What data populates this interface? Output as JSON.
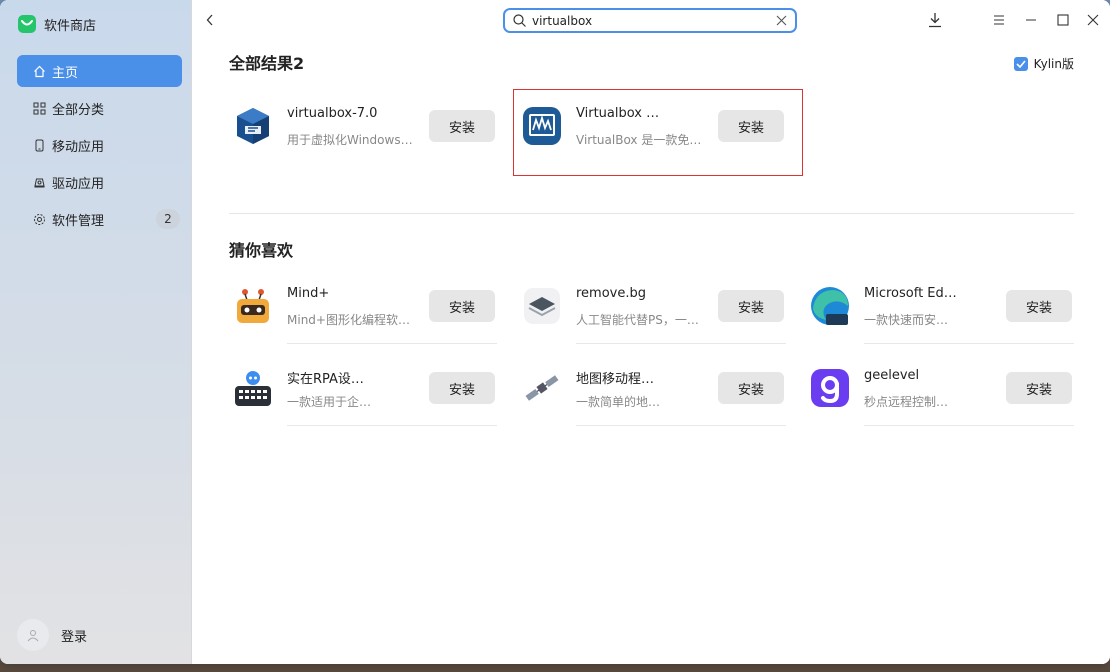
{
  "app": {
    "title": "软件商店"
  },
  "sidebar": {
    "items": [
      {
        "label": "主页",
        "icon": "home-icon",
        "active": true
      },
      {
        "label": "全部分类",
        "icon": "grid-icon"
      },
      {
        "label": "移动应用",
        "icon": "phone-icon"
      },
      {
        "label": "驱动应用",
        "icon": "driver-icon"
      },
      {
        "label": "软件管理",
        "icon": "gear-icon",
        "badge": "2"
      }
    ],
    "login_label": "登录"
  },
  "search": {
    "value": "virtualbox"
  },
  "filter": {
    "label": "Kylin版",
    "checked": true
  },
  "results": {
    "title": "全部结果2",
    "apps": [
      {
        "name": "virtualbox-7.0",
        "desc": "用于虚拟化Windows…",
        "button": "安装",
        "icon": "virtualbox-cube-icon"
      },
      {
        "name": "Virtualbox …",
        "desc": "VirtualBox 是一款免…",
        "button": "安装",
        "icon": "virtualbox-monitor-icon"
      }
    ]
  },
  "recommend": {
    "title": "猜你喜欢",
    "apps": [
      {
        "name": "Mind+",
        "desc": "Mind+图形化编程软…",
        "button": "安装",
        "icon": "mindplus-robot-icon"
      },
      {
        "name": "remove.bg",
        "desc": "人工智能代替PS，一…",
        "button": "安装",
        "icon": "removebg-layers-icon"
      },
      {
        "name": "Microsoft Ed…",
        "desc": "一款快速而安…",
        "button": "安装",
        "icon": "edge-dev-icon"
      },
      {
        "name": "实在RPA设…",
        "desc": "一款适用于企…",
        "button": "安装",
        "icon": "rpa-robot-icon"
      },
      {
        "name": "地图移动程…",
        "desc": "一款简单的地…",
        "button": "安装",
        "icon": "satellite-icon"
      },
      {
        "name": "geelevel",
        "desc": "秒点远程控制…",
        "button": "安装",
        "icon": "geelevel-g-icon"
      }
    ]
  },
  "colors": {
    "accent": "#4a8fe8",
    "highlight": "#dd3333"
  }
}
